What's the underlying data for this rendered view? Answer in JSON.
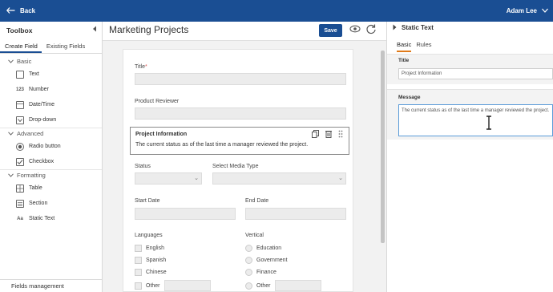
{
  "topbar": {
    "back_label": "Back",
    "user_name": "Adam Lee"
  },
  "toolbox": {
    "title": "Toolbox",
    "tabs": [
      "Create Field",
      "Existing Fields"
    ],
    "sections": [
      {
        "label": "Basic",
        "items": [
          {
            "label": "Text",
            "icon": "text-icon"
          },
          {
            "label": "Number",
            "icon": "number-icon"
          },
          {
            "label": "Date/Time",
            "icon": "calendar-icon"
          },
          {
            "label": "Drop-down",
            "icon": "dropdown-icon"
          }
        ]
      },
      {
        "label": "Advanced",
        "items": [
          {
            "label": "Radio button",
            "icon": "radio-icon"
          },
          {
            "label": "Checkbox",
            "icon": "checkbox-icon"
          }
        ]
      },
      {
        "label": "Formatting",
        "items": [
          {
            "label": "Table",
            "icon": "table-icon"
          },
          {
            "label": "Section",
            "icon": "section-icon"
          },
          {
            "label": "Static Text",
            "icon": "static-text-icon"
          }
        ]
      }
    ],
    "number_glyph": "123",
    "static_text_glyph": "Aa",
    "footer": "Fields management"
  },
  "form": {
    "title": "Marketing Projects",
    "save_label": "Save",
    "fields": {
      "title": "Title",
      "required_mark": "*",
      "product_reviewer": "Product Reviewer",
      "status": "Status",
      "media_type": "Select Media Type",
      "start_date": "Start Date",
      "end_date": "End Date",
      "languages": "Languages",
      "vertical": "Vertical"
    },
    "selected_block": {
      "title": "Project Information",
      "message": "The current status as of the last time a manager reviewed the project."
    },
    "languages": [
      "English",
      "Spanish",
      "Chinese",
      "Other"
    ],
    "verticals": [
      "Education",
      "Government",
      "Finance",
      "Other"
    ]
  },
  "properties": {
    "title": "Static Text",
    "tabs": [
      "Basic",
      "Rules"
    ],
    "title_label": "Title",
    "title_value": "Project Information",
    "message_label": "Message",
    "message_value": "The current status as of the last time a manager reviewed the project."
  },
  "colors": {
    "topbar": "#1a4e93",
    "save_button": "#1a4e93",
    "tab_accent": "#e07a1a",
    "textarea_focus": "#5a9bd8"
  }
}
